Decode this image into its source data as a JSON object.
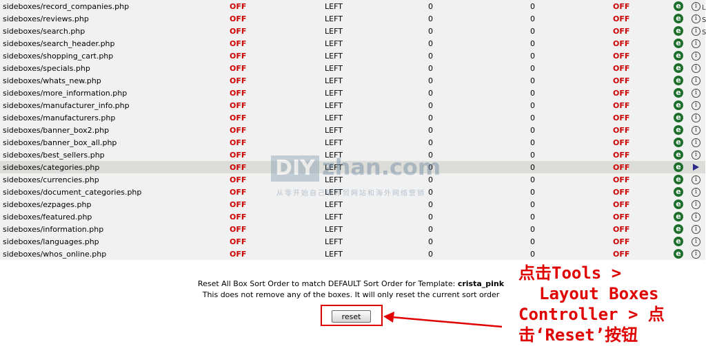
{
  "boxes": [
    {
      "file": "sideboxes/record_companies.php",
      "status": "OFF",
      "column": "LEFT",
      "left_sort": "0",
      "right_sort": "0",
      "single": "OFF"
    },
    {
      "file": "sideboxes/reviews.php",
      "status": "OFF",
      "column": "LEFT",
      "left_sort": "0",
      "right_sort": "0",
      "single": "OFF"
    },
    {
      "file": "sideboxes/search.php",
      "status": "OFF",
      "column": "LEFT",
      "left_sort": "0",
      "right_sort": "0",
      "single": "OFF"
    },
    {
      "file": "sideboxes/search_header.php",
      "status": "OFF",
      "column": "LEFT",
      "left_sort": "0",
      "right_sort": "0",
      "single": "OFF"
    },
    {
      "file": "sideboxes/shopping_cart.php",
      "status": "OFF",
      "column": "LEFT",
      "left_sort": "0",
      "right_sort": "0",
      "single": "OFF"
    },
    {
      "file": "sideboxes/specials.php",
      "status": "OFF",
      "column": "LEFT",
      "left_sort": "0",
      "right_sort": "0",
      "single": "OFF"
    },
    {
      "file": "sideboxes/whats_new.php",
      "status": "OFF",
      "column": "LEFT",
      "left_sort": "0",
      "right_sort": "0",
      "single": "OFF"
    },
    {
      "file": "sideboxes/more_information.php",
      "status": "OFF",
      "column": "LEFT",
      "left_sort": "0",
      "right_sort": "0",
      "single": "OFF"
    },
    {
      "file": "sideboxes/manufacturer_info.php",
      "status": "OFF",
      "column": "LEFT",
      "left_sort": "0",
      "right_sort": "0",
      "single": "OFF"
    },
    {
      "file": "sideboxes/manufacturers.php",
      "status": "OFF",
      "column": "LEFT",
      "left_sort": "0",
      "right_sort": "0",
      "single": "OFF"
    },
    {
      "file": "sideboxes/banner_box2.php",
      "status": "OFF",
      "column": "LEFT",
      "left_sort": "0",
      "right_sort": "0",
      "single": "OFF"
    },
    {
      "file": "sideboxes/banner_box_all.php",
      "status": "OFF",
      "column": "LEFT",
      "left_sort": "0",
      "right_sort": "0",
      "single": "OFF"
    },
    {
      "file": "sideboxes/best_sellers.php",
      "status": "OFF",
      "column": "LEFT",
      "left_sort": "0",
      "right_sort": "0",
      "single": "OFF"
    },
    {
      "file": "sideboxes/categories.php",
      "status": "OFF",
      "column": "LEFT",
      "left_sort": "0",
      "right_sort": "0",
      "single": "OFF",
      "selected": true
    },
    {
      "file": "sideboxes/currencies.php",
      "status": "OFF",
      "column": "LEFT",
      "left_sort": "0",
      "right_sort": "0",
      "single": "OFF"
    },
    {
      "file": "sideboxes/document_categories.php",
      "status": "OFF",
      "column": "LEFT",
      "left_sort": "0",
      "right_sort": "0",
      "single": "OFF"
    },
    {
      "file": "sideboxes/ezpages.php",
      "status": "OFF",
      "column": "LEFT",
      "left_sort": "0",
      "right_sort": "0",
      "single": "OFF"
    },
    {
      "file": "sideboxes/featured.php",
      "status": "OFF",
      "column": "LEFT",
      "left_sort": "0",
      "right_sort": "0",
      "single": "OFF"
    },
    {
      "file": "sideboxes/information.php",
      "status": "OFF",
      "column": "LEFT",
      "left_sort": "0",
      "right_sort": "0",
      "single": "OFF"
    },
    {
      "file": "sideboxes/languages.php",
      "status": "OFF",
      "column": "LEFT",
      "left_sort": "0",
      "right_sort": "0",
      "single": "OFF"
    },
    {
      "file": "sideboxes/whos_online.php",
      "status": "OFF",
      "column": "LEFT",
      "left_sort": "0",
      "right_sort": "0",
      "single": "OFF"
    }
  ],
  "icons": {
    "edit_glyph": "e",
    "info_glyph": "i",
    "edit_icon": "edit-icon",
    "info_icon": "info-icon",
    "selected_icon": "arrow-right-icon",
    "edit_color": "#1c6e2a"
  },
  "side_letters": [
    "L",
    "S",
    "S"
  ],
  "watermark": {
    "box": "DIY",
    "text": "zhan.com",
    "sub": "从零开始自己做外贸网站和海外网络营销"
  },
  "reset_section": {
    "line1_prefix": "Reset All Box Sort Order to match DEFAULT Sort Order for Template:",
    "template_name": "crista_pink",
    "line2": "This does not remove any of the boxes. It will only reset the current sort order",
    "button_label": "reset"
  },
  "callout": {
    "lines": [
      "点击Tools >",
      "Layout Boxes",
      "Controller > 点",
      "击‘Reset’按钮"
    ],
    "color": "#e00000"
  },
  "colors": {
    "status_red": "#cc0000",
    "row_bg": "#f1f1f1",
    "row_selected_bg": "#dcdcd8"
  }
}
